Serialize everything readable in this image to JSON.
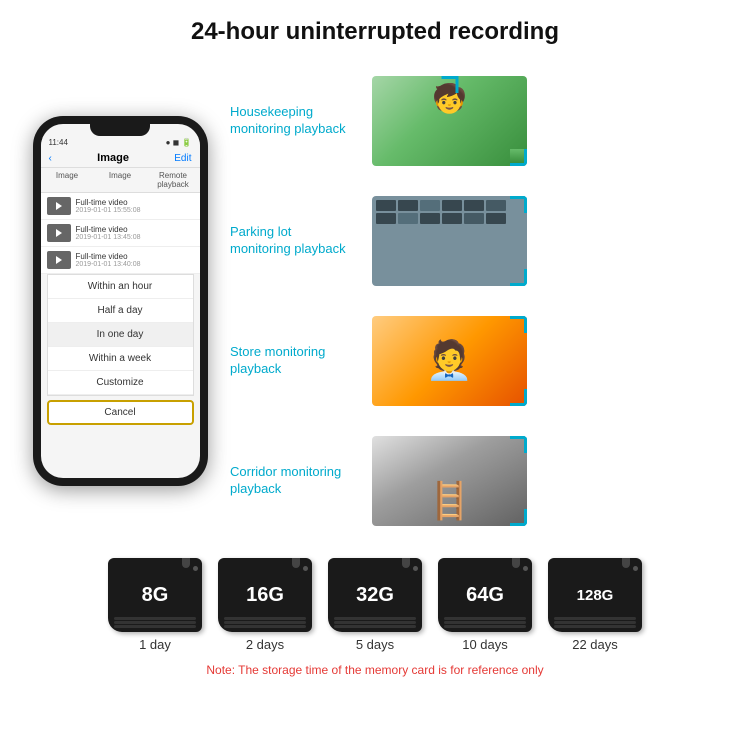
{
  "header": {
    "title": "24-hour uninterrupted recording"
  },
  "phone": {
    "time": "11:44",
    "screen_title": "Image",
    "back": "‹",
    "edit": "Edit",
    "tabs": [
      "Image",
      "Image",
      "Remote playback"
    ],
    "list_items": [
      {
        "label": "Full-time video",
        "date": "2019-01-01 15:55:08"
      },
      {
        "label": "Full-time video",
        "date": "2019-01-01 13:45:08"
      },
      {
        "label": "Full-time video",
        "date": "2019-01-01 13:40:08"
      }
    ],
    "dropdown": [
      "Within an hour",
      "Half a day",
      "In one day",
      "Within a week",
      "Customize"
    ],
    "cancel": "Cancel"
  },
  "monitoring": [
    {
      "label": "Housekeeping\nmonitoring playback",
      "img_class": "img-housekeeping"
    },
    {
      "label": "Parking lot\nmonitoring playback",
      "img_class": "img-parking"
    },
    {
      "label": "Store monitoring\nplayback",
      "img_class": "img-store"
    },
    {
      "label": "Corridor monitoring\nplayback",
      "img_class": "img-corridor"
    }
  ],
  "storage": {
    "cards": [
      {
        "size": "8G",
        "days": "1 day"
      },
      {
        "size": "16G",
        "days": "2 days"
      },
      {
        "size": "32G",
        "days": "5 days"
      },
      {
        "size": "64G",
        "days": "10 days"
      },
      {
        "size": "128G",
        "days": "22 days"
      }
    ],
    "note": "Note: The storage time of the memory card is for reference only"
  }
}
